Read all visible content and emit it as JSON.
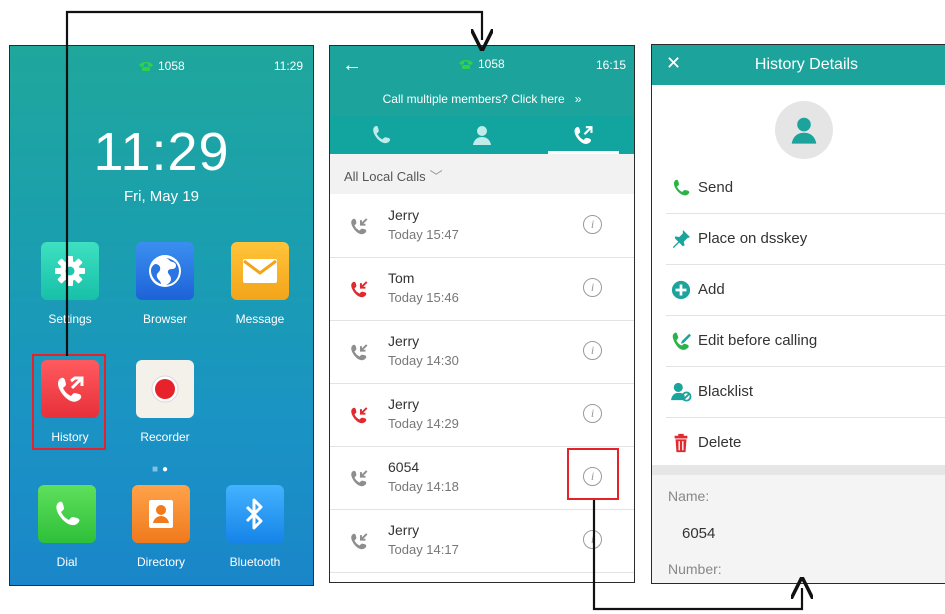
{
  "home": {
    "extension": "1058",
    "status_time": "11:29",
    "clock": "11:29",
    "date": "Fri, May 19",
    "apps": [
      {
        "label": "Settings"
      },
      {
        "label": "Browser"
      },
      {
        "label": "Message"
      },
      {
        "label": "History"
      },
      {
        "label": "Recorder"
      },
      {
        "label": "Dial"
      },
      {
        "label": "Directory"
      },
      {
        "label": "Bluetooth"
      }
    ]
  },
  "calllog": {
    "back": "←",
    "extension": "1058",
    "status_time": "16:15",
    "banner": "Call multiple members? Click here",
    "banner_arrow": "»",
    "filter": "All Local Calls",
    "calls": [
      {
        "name": "Jerry",
        "time": "Today 15:47",
        "type": "missed-grey"
      },
      {
        "name": "Tom",
        "time": "Today 15:46",
        "type": "missed-red"
      },
      {
        "name": "Jerry",
        "time": "Today 14:30",
        "type": "missed-grey"
      },
      {
        "name": "Jerry",
        "time": "Today 14:29",
        "type": "missed-red"
      },
      {
        "name": "6054",
        "time": "Today 14:18",
        "type": "missed-grey"
      },
      {
        "name": "Jerry",
        "time": "Today 14:17",
        "type": "missed-grey"
      }
    ],
    "info_glyph": "i"
  },
  "details": {
    "close": "✕",
    "title": "History Details",
    "options": [
      {
        "label": "Send",
        "icon": "phone-icon"
      },
      {
        "label": "Place on dsskey",
        "icon": "pin-icon"
      },
      {
        "label": "Add",
        "icon": "add-icon"
      },
      {
        "label": "Edit before calling",
        "icon": "edit-call-icon"
      },
      {
        "label": "Blacklist",
        "icon": "blacklist-icon"
      },
      {
        "label": "Delete",
        "icon": "trash-icon"
      }
    ],
    "name_label": "Name:",
    "name_value": "6054",
    "number_label": "Number:"
  },
  "colors": {
    "teal": "#1ba39c",
    "highlight_red": "#e52229",
    "missed_red": "#e02a2f"
  }
}
